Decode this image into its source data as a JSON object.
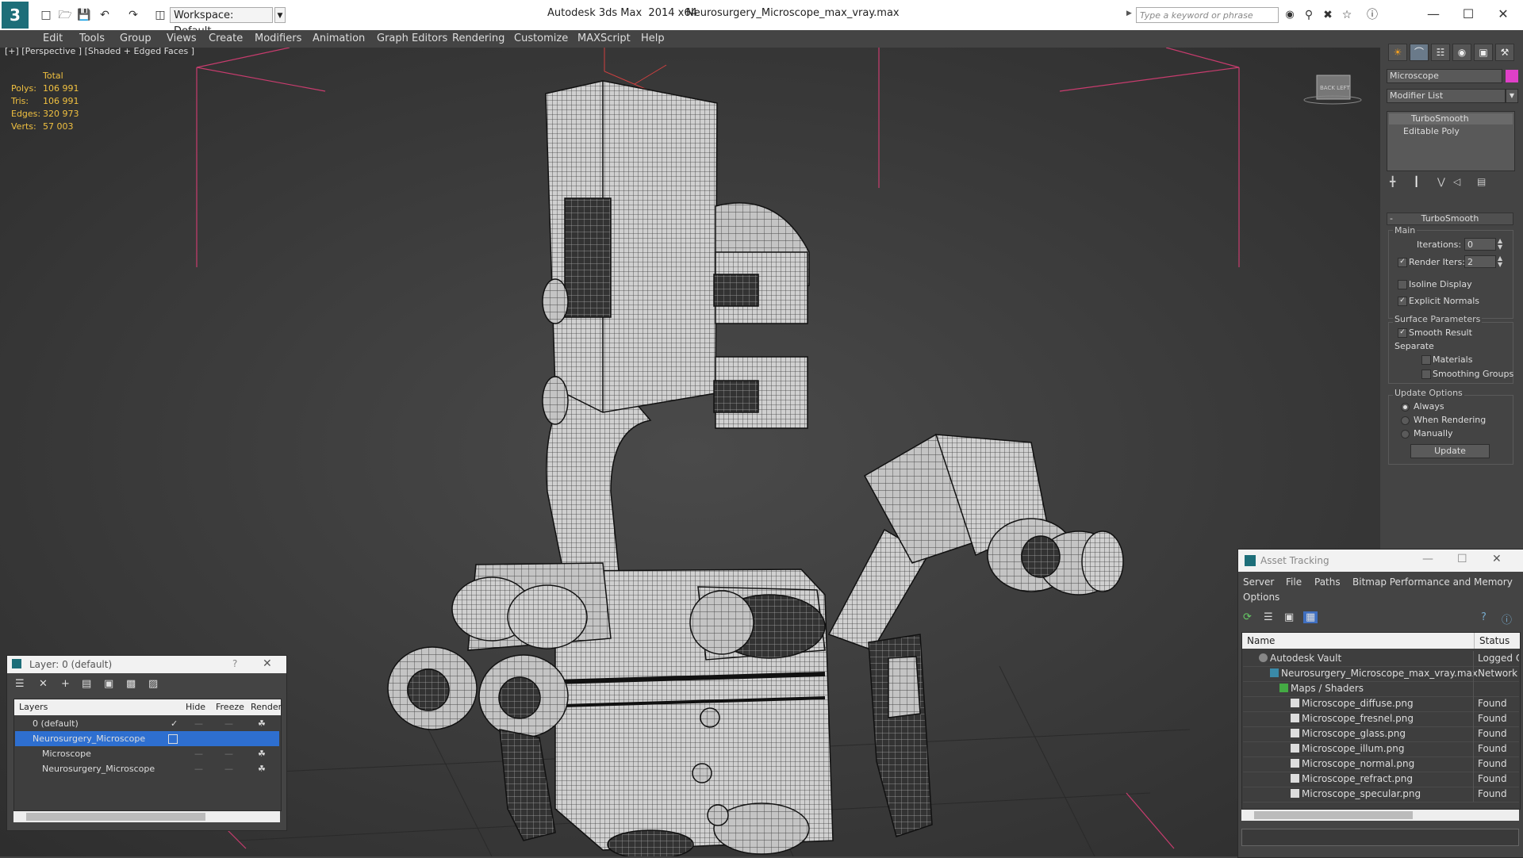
{
  "window": {
    "app_title": "Autodesk 3ds Max  2014 x64",
    "file_title": "Neurosurgery_Microscope_max_vray.max",
    "workspace": "Workspace: Default",
    "search_placeholder": "Type a keyword or phrase"
  },
  "menu": [
    "Edit",
    "Tools",
    "Group",
    "Views",
    "Create",
    "Modifiers",
    "Animation",
    "Graph Editors",
    "Rendering",
    "Customize",
    "MAXScript",
    "Help"
  ],
  "viewport": {
    "label": "[+] [Perspective ] [Shaded + Edged Faces ]",
    "stats_header": "Total",
    "stats": [
      {
        "label": "Polys:",
        "value": "106 991"
      },
      {
        "label": "Tris:",
        "value": "106 991"
      },
      {
        "label": "Edges:",
        "value": "320 973"
      },
      {
        "label": "Verts:",
        "value": "57 003"
      }
    ],
    "viewcube_label": "BACK LEFT"
  },
  "command_panel": {
    "object_name": "Microscope",
    "object_color": "#e040c8",
    "modifier_list": "Modifier List",
    "stack": [
      "TurboSmooth",
      "Editable Poly"
    ],
    "rollout_title": "TurboSmooth",
    "main_label": "Main",
    "iterations_label": "Iterations:",
    "iterations_value": "0",
    "render_iters_label": "Render Iters:",
    "render_iters_value": "2",
    "isoline_label": "Isoline Display",
    "explicit_normals_label": "Explicit Normals",
    "surface_params_label": "Surface Parameters",
    "smooth_result_label": "Smooth Result",
    "separate_label": "Separate",
    "materials_label": "Materials",
    "smoothing_groups_label": "Smoothing Groups",
    "update_options_label": "Update Options",
    "always_label": "Always",
    "when_rendering_label": "When Rendering",
    "manually_label": "Manually",
    "update_button": "Update"
  },
  "layer_panel": {
    "title": "Layer: 0 (default)",
    "help": "?",
    "columns": [
      "Layers",
      "Hide",
      "Freeze",
      "Render"
    ],
    "rows": [
      {
        "name": "0 (default)",
        "selected": false
      },
      {
        "name": "Neurosurgery_Microscope",
        "selected": true
      },
      {
        "name": "Microscope",
        "selected": false
      },
      {
        "name": "Neurosurgery_Microscope",
        "selected": false
      }
    ]
  },
  "asset_tracking": {
    "title": "Asset Tracking",
    "menu": [
      "Server",
      "File",
      "Paths",
      "Bitmap Performance and Memory"
    ],
    "menu2": "Options",
    "columns": [
      "Name",
      "Status"
    ],
    "rows": [
      {
        "name": "Autodesk Vault",
        "status": "Logged O"
      },
      {
        "name": "Neurosurgery_Microscope_max_vray.max",
        "status": "Network"
      },
      {
        "name": "Maps / Shaders",
        "status": ""
      },
      {
        "name": "Microscope_diffuse.png",
        "status": "Found"
      },
      {
        "name": "Microscope_fresnel.png",
        "status": "Found"
      },
      {
        "name": "Microscope_glass.png",
        "status": "Found"
      },
      {
        "name": "Microscope_illum.png",
        "status": "Found"
      },
      {
        "name": "Microscope_normal.png",
        "status": "Found"
      },
      {
        "name": "Microscope_refract.png",
        "status": "Found"
      },
      {
        "name": "Microscope_specular.png",
        "status": "Found"
      }
    ]
  }
}
